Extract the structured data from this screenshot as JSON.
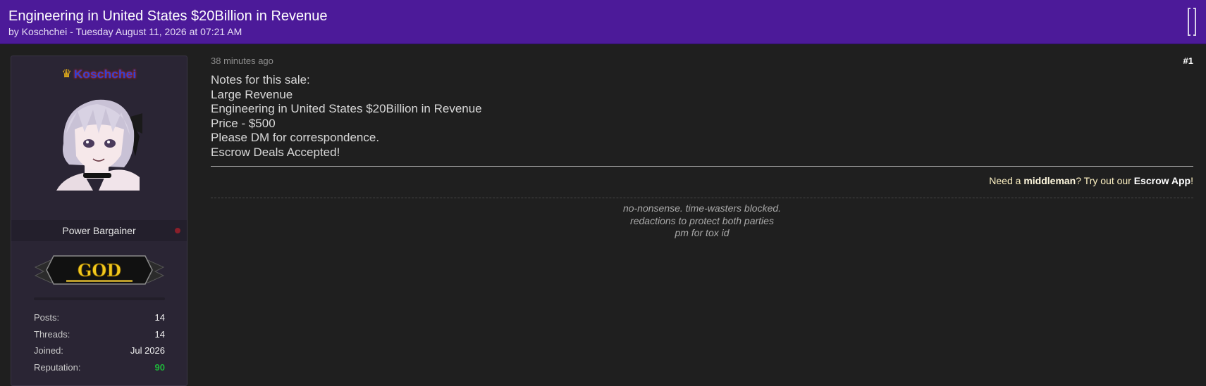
{
  "thread": {
    "title": "Engineering in United States $20Billion in Revenue",
    "byline": "by Koschchei - Tuesday August 11, 2026 at 07:21 AM"
  },
  "user": {
    "username": "Koschchei",
    "rank": "Power Bargainer",
    "badge": "GOD",
    "stats": [
      {
        "label": "Posts:",
        "value": "14"
      },
      {
        "label": "Threads:",
        "value": "14"
      },
      {
        "label": "Joined:",
        "value": "Jul 2026"
      },
      {
        "label": "Reputation:",
        "value": "90"
      }
    ]
  },
  "post": {
    "time": "38 minutes ago",
    "number": "#1",
    "lines": [
      "Notes for this sale:",
      "Large Revenue",
      "Engineering in United States $20Billion in Revenue",
      "Price - $500",
      "Please DM for correspondence.",
      "Escrow Deals Accepted!"
    ],
    "promo": {
      "prefix": "Need a ",
      "middleman": "middleman",
      "middle": "? Try out our ",
      "app": "Escrow App",
      "suffix": "!"
    },
    "signature": [
      "no-nonsense. time-wasters blocked.",
      "redactions to protect both parties",
      "pm for tox id"
    ]
  },
  "colors": {
    "header": "#4c1a99",
    "background": "#1f1f1f",
    "panel": "#2a2534",
    "reputation": "#1eb53a",
    "username": "#2b43d6"
  },
  "icons": [
    "crown-icon",
    "bracket-icon",
    "status-dot"
  ]
}
